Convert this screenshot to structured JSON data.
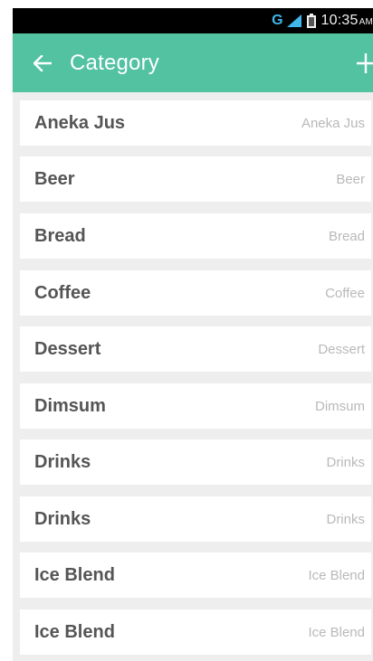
{
  "status_bar": {
    "network": "G",
    "time": "10:35",
    "ampm": "AM",
    "signal_icon": "signal-icon",
    "battery_icon": "battery-icon"
  },
  "app_bar": {
    "title": "Category",
    "background": "#52c2a1",
    "back_icon": "arrow-left-icon",
    "add_icon": "plus-icon"
  },
  "categories": [
    {
      "name": "Aneka Jus",
      "secondary": "Aneka Jus"
    },
    {
      "name": "Beer",
      "secondary": "Beer"
    },
    {
      "name": "Bread",
      "secondary": "Bread"
    },
    {
      "name": "Coffee",
      "secondary": "Coffee"
    },
    {
      "name": "Dessert",
      "secondary": "Dessert"
    },
    {
      "name": "Dimsum",
      "secondary": "Dimsum"
    },
    {
      "name": "Drinks",
      "secondary": "Drinks"
    },
    {
      "name": "Drinks",
      "secondary": "Drinks"
    },
    {
      "name": "Ice Blend",
      "secondary": "Ice Blend"
    },
    {
      "name": "Ice Blend",
      "secondary": "Ice Blend"
    }
  ]
}
